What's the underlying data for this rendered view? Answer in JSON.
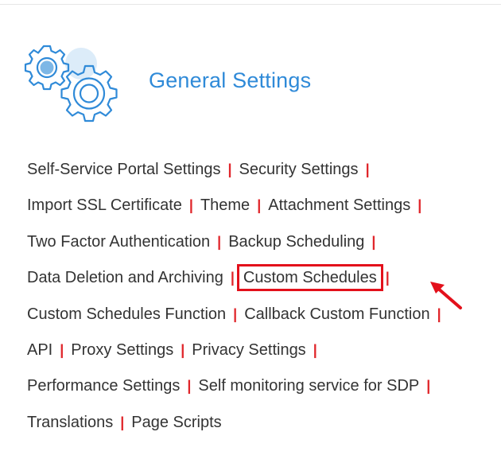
{
  "section": {
    "title": "General Settings",
    "icon": "gears-icon"
  },
  "rows": [
    [
      "Self-Service Portal Settings",
      "Security Settings"
    ],
    [
      "Import SSL Certificate",
      "Theme",
      "Attachment Settings"
    ],
    [
      "Two Factor Authentication",
      "Backup Scheduling"
    ],
    [
      "Data Deletion and Archiving",
      "Custom Schedules"
    ],
    [
      "Custom Schedules Function",
      "Callback Custom Function"
    ],
    [
      "API",
      "Proxy Settings",
      "Privacy Settings"
    ],
    [
      "Performance Settings",
      "Self monitoring service for SDP"
    ],
    [
      "Translations",
      "Page Scripts"
    ]
  ],
  "separator": "|",
  "highlighted_item": "Custom Schedules",
  "colors": {
    "accent": "#2f8ad8",
    "separator": "#e0262b",
    "highlight_box": "#e3101b",
    "text": "#333333"
  }
}
